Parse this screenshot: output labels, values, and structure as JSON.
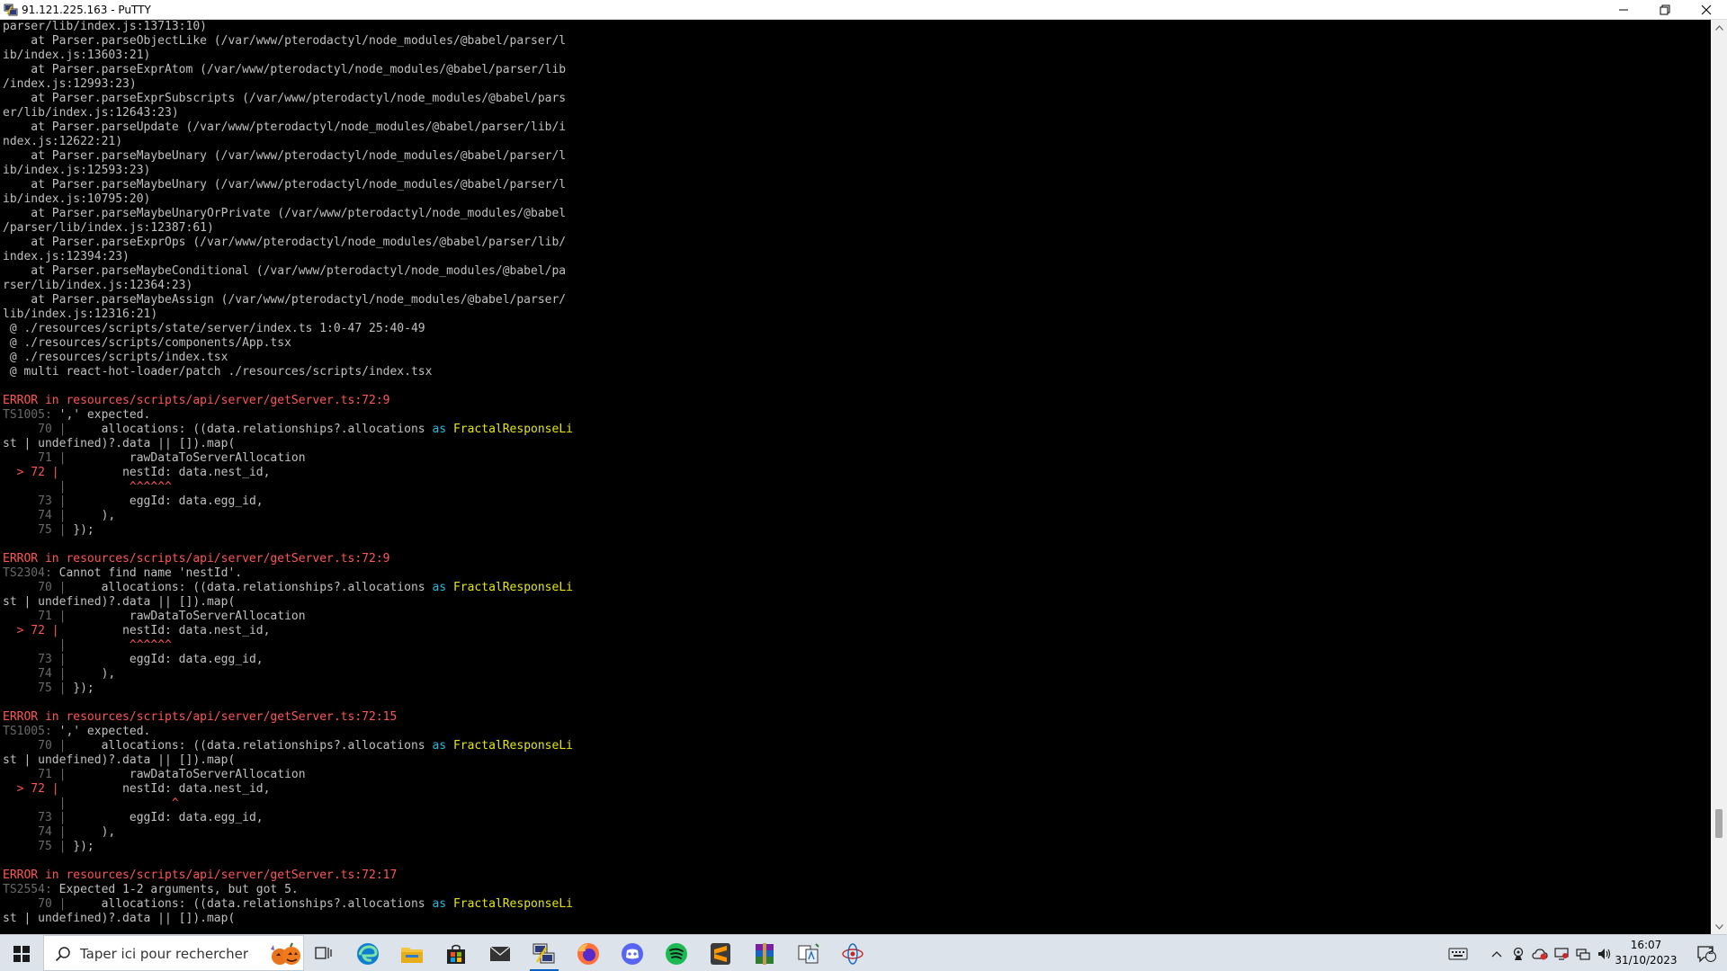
{
  "window": {
    "title": "91.121.225.163 - PuTTY"
  },
  "terminal": {
    "lines": [
      [
        {
          "t": "parser/lib/index.js:13713:10)",
          "c": ""
        }
      ],
      [
        {
          "t": "    at Parser.parseObjectLike (/var/www/pterodactyl/node_modules/@babel/parser/l",
          "c": ""
        }
      ],
      [
        {
          "t": "ib/index.js:13603:21)",
          "c": ""
        }
      ],
      [
        {
          "t": "    at Parser.parseExprAtom (/var/www/pterodactyl/node_modules/@babel/parser/lib",
          "c": ""
        }
      ],
      [
        {
          "t": "/index.js:12993:23)",
          "c": ""
        }
      ],
      [
        {
          "t": "    at Parser.parseExprSubscripts (/var/www/pterodactyl/node_modules/@babel/pars",
          "c": ""
        }
      ],
      [
        {
          "t": "er/lib/index.js:12643:23)",
          "c": ""
        }
      ],
      [
        {
          "t": "    at Parser.parseUpdate (/var/www/pterodactyl/node_modules/@babel/parser/lib/i",
          "c": ""
        }
      ],
      [
        {
          "t": "ndex.js:12622:21)",
          "c": ""
        }
      ],
      [
        {
          "t": "    at Parser.parseMaybeUnary (/var/www/pterodactyl/node_modules/@babel/parser/l",
          "c": ""
        }
      ],
      [
        {
          "t": "ib/index.js:12593:23)",
          "c": ""
        }
      ],
      [
        {
          "t": "    at Parser.parseMaybeUnary (/var/www/pterodactyl/node_modules/@babel/parser/l",
          "c": ""
        }
      ],
      [
        {
          "t": "ib/index.js:10795:20)",
          "c": ""
        }
      ],
      [
        {
          "t": "    at Parser.parseMaybeUnaryOrPrivate (/var/www/pterodactyl/node_modules/@babel",
          "c": ""
        }
      ],
      [
        {
          "t": "/parser/lib/index.js:12387:61)",
          "c": ""
        }
      ],
      [
        {
          "t": "    at Parser.parseExprOps (/var/www/pterodactyl/node_modules/@babel/parser/lib/",
          "c": ""
        }
      ],
      [
        {
          "t": "index.js:12394:23)",
          "c": ""
        }
      ],
      [
        {
          "t": "    at Parser.parseMaybeConditional (/var/www/pterodactyl/node_modules/@babel/pa",
          "c": ""
        }
      ],
      [
        {
          "t": "rser/lib/index.js:12364:23)",
          "c": ""
        }
      ],
      [
        {
          "t": "    at Parser.parseMaybeAssign (/var/www/pterodactyl/node_modules/@babel/parser/",
          "c": ""
        }
      ],
      [
        {
          "t": "lib/index.js:12316:21)",
          "c": ""
        }
      ],
      [
        {
          "t": " @ ./resources/scripts/state/server/index.ts 1:0-47 25:40-49",
          "c": ""
        }
      ],
      [
        {
          "t": " @ ./resources/scripts/components/App.tsx",
          "c": ""
        }
      ],
      [
        {
          "t": " @ ./resources/scripts/index.tsx",
          "c": ""
        }
      ],
      [
        {
          "t": " @ multi react-hot-loader/patch ./resources/scripts/index.tsx",
          "c": ""
        }
      ],
      [],
      [
        {
          "t": "ERROR in resources/scripts/api/server/getServer.ts:72:9",
          "c": "err"
        }
      ],
      [
        {
          "t": "TS1005:",
          "c": "dim"
        },
        {
          "t": " ',' expected.",
          "c": ""
        }
      ],
      [
        {
          "t": "     70 |",
          "c": "dim"
        },
        {
          "t": "     allocations: ((data.relationships?.allocations ",
          "c": ""
        },
        {
          "t": "as",
          "c": "kw"
        },
        {
          "t": " ",
          "c": ""
        },
        {
          "t": "FractalResponseLi",
          "c": "type"
        }
      ],
      [
        {
          "t": "st | undefined)?.data || []).map(",
          "c": ""
        }
      ],
      [
        {
          "t": "     71 |",
          "c": "dim"
        },
        {
          "t": "         rawDataToServerAllocation",
          "c": ""
        }
      ],
      [
        {
          "t": "  > 72 |",
          "c": "warn"
        },
        {
          "t": "         nestId: data.nest_id,",
          "c": ""
        }
      ],
      [
        {
          "t": "        |",
          "c": "dim"
        },
        {
          "t": "         ^^^^^^",
          "c": "caret"
        }
      ],
      [
        {
          "t": "     73 |",
          "c": "dim"
        },
        {
          "t": "         eggId: data.egg_id,",
          "c": ""
        }
      ],
      [
        {
          "t": "     74 |",
          "c": "dim"
        },
        {
          "t": "     ),",
          "c": ""
        }
      ],
      [
        {
          "t": "     75 |",
          "c": "dim"
        },
        {
          "t": " });",
          "c": ""
        }
      ],
      [],
      [
        {
          "t": "ERROR in resources/scripts/api/server/getServer.ts:72:9",
          "c": "err"
        }
      ],
      [
        {
          "t": "TS2304:",
          "c": "dim"
        },
        {
          "t": " Cannot find name 'nestId'.",
          "c": ""
        }
      ],
      [
        {
          "t": "     70 |",
          "c": "dim"
        },
        {
          "t": "     allocations: ((data.relationships?.allocations ",
          "c": ""
        },
        {
          "t": "as",
          "c": "kw"
        },
        {
          "t": " ",
          "c": ""
        },
        {
          "t": "FractalResponseLi",
          "c": "type"
        }
      ],
      [
        {
          "t": "st | undefined)?.data || []).map(",
          "c": ""
        }
      ],
      [
        {
          "t": "     71 |",
          "c": "dim"
        },
        {
          "t": "         rawDataToServerAllocation",
          "c": ""
        }
      ],
      [
        {
          "t": "  > 72 |",
          "c": "warn"
        },
        {
          "t": "         nestId: data.nest_id,",
          "c": ""
        }
      ],
      [
        {
          "t": "        |",
          "c": "dim"
        },
        {
          "t": "         ^^^^^^",
          "c": "caret"
        }
      ],
      [
        {
          "t": "     73 |",
          "c": "dim"
        },
        {
          "t": "         eggId: data.egg_id,",
          "c": ""
        }
      ],
      [
        {
          "t": "     74 |",
          "c": "dim"
        },
        {
          "t": "     ),",
          "c": ""
        }
      ],
      [
        {
          "t": "     75 |",
          "c": "dim"
        },
        {
          "t": " });",
          "c": ""
        }
      ],
      [],
      [
        {
          "t": "ERROR in resources/scripts/api/server/getServer.ts:72:15",
          "c": "err"
        }
      ],
      [
        {
          "t": "TS1005:",
          "c": "dim"
        },
        {
          "t": " ',' expected.",
          "c": ""
        }
      ],
      [
        {
          "t": "     70 |",
          "c": "dim"
        },
        {
          "t": "     allocations: ((data.relationships?.allocations ",
          "c": ""
        },
        {
          "t": "as",
          "c": "kw"
        },
        {
          "t": " ",
          "c": ""
        },
        {
          "t": "FractalResponseLi",
          "c": "type"
        }
      ],
      [
        {
          "t": "st | undefined)?.data || []).map(",
          "c": ""
        }
      ],
      [
        {
          "t": "     71 |",
          "c": "dim"
        },
        {
          "t": "         rawDataToServerAllocation",
          "c": ""
        }
      ],
      [
        {
          "t": "  > 72 |",
          "c": "warn"
        },
        {
          "t": "         nestId: data.nest_id,",
          "c": ""
        }
      ],
      [
        {
          "t": "        |",
          "c": "dim"
        },
        {
          "t": "               ^",
          "c": "caret"
        }
      ],
      [
        {
          "t": "     73 |",
          "c": "dim"
        },
        {
          "t": "         eggId: data.egg_id,",
          "c": ""
        }
      ],
      [
        {
          "t": "     74 |",
          "c": "dim"
        },
        {
          "t": "     ),",
          "c": ""
        }
      ],
      [
        {
          "t": "     75 |",
          "c": "dim"
        },
        {
          "t": " });",
          "c": ""
        }
      ],
      [],
      [
        {
          "t": "ERROR in resources/scripts/api/server/getServer.ts:72:17",
          "c": "err"
        }
      ],
      [
        {
          "t": "TS2554:",
          "c": "dim"
        },
        {
          "t": " Expected 1-2 arguments, but got 5.",
          "c": ""
        }
      ],
      [
        {
          "t": "     70 |",
          "c": "dim"
        },
        {
          "t": "     allocations: ((data.relationships?.allocations ",
          "c": ""
        },
        {
          "t": "as",
          "c": "kw"
        },
        {
          "t": " ",
          "c": ""
        },
        {
          "t": "FractalResponseLi",
          "c": "type"
        }
      ],
      [
        {
          "t": "st | undefined)?.data || []).map(",
          "c": ""
        }
      ]
    ]
  },
  "taskbar": {
    "search_placeholder": "Taper ici pour rechercher",
    "apps": [
      {
        "name": "task-view-icon",
        "active": false
      },
      {
        "name": "edge-icon",
        "active": false
      },
      {
        "name": "file-explorer-icon",
        "active": false
      },
      {
        "name": "microsoft-store-icon",
        "active": false
      },
      {
        "name": "mail-icon",
        "active": false
      },
      {
        "name": "putty-icon",
        "active": true
      },
      {
        "name": "firefox-icon",
        "active": false
      },
      {
        "name": "discord-icon",
        "active": false
      },
      {
        "name": "spotify-icon",
        "active": false
      },
      {
        "name": "sublime-text-icon",
        "active": false
      },
      {
        "name": "winrar-icon",
        "active": false
      },
      {
        "name": "translator-icon",
        "active": false
      },
      {
        "name": "network-app-icon",
        "active": false
      }
    ],
    "clock_time": "16:07",
    "clock_date": "31/10/2023",
    "notification_count": "2"
  },
  "colors": {
    "terminal_bg": "#000000",
    "terminal_fg": "#c0c0c0",
    "error_red": "#ff5555",
    "keyword_cyan": "#29b8db",
    "type_yellow": "#e5e510",
    "dim_gray": "#6a6a6a"
  }
}
